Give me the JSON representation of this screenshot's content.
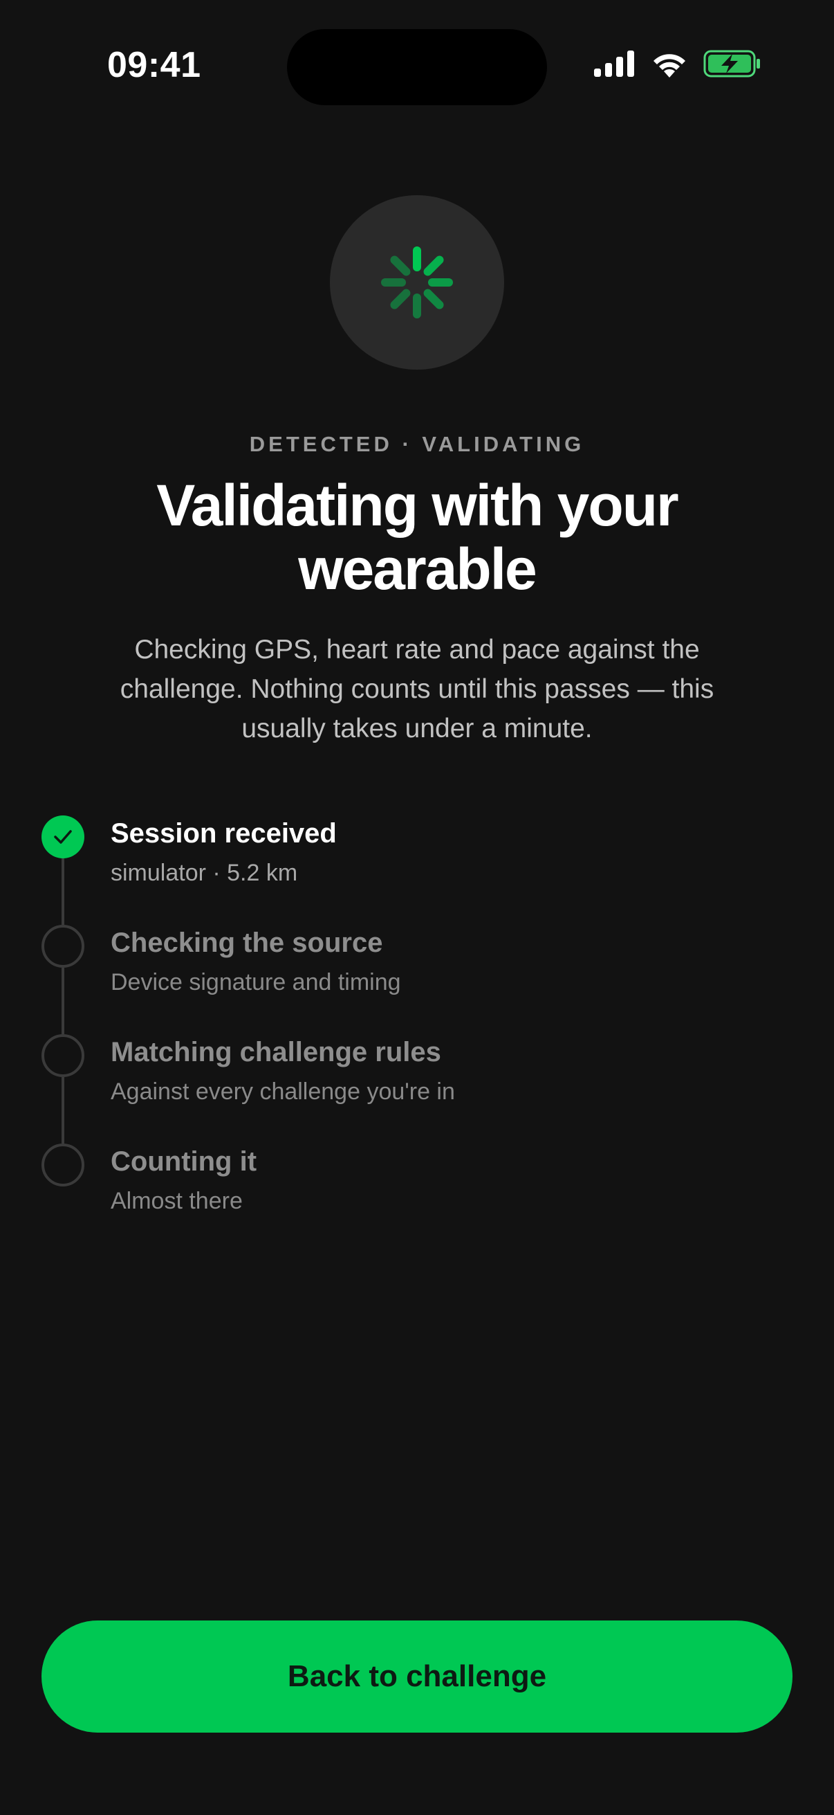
{
  "status_bar": {
    "time": "09:41",
    "icons": [
      "cellular-signal-icon",
      "wifi-icon",
      "battery-charging-icon"
    ]
  },
  "loader": {
    "icon": "spinner-icon",
    "accent_color": "#00c853"
  },
  "header": {
    "eyebrow": "DETECTED · VALIDATING",
    "title": "Validating with your wearable",
    "subtitle": "Checking GPS, heart rate and pace against the challenge. Nothing counts until this passes — this usually takes under a minute."
  },
  "steps": [
    {
      "title": "Session received",
      "desc": "simulator · 5.2 km",
      "status": "done"
    },
    {
      "title": "Checking the source",
      "desc": "Device signature and timing",
      "status": "pending"
    },
    {
      "title": "Matching challenge rules",
      "desc": "Against every challenge you're in",
      "status": "pending"
    },
    {
      "title": "Counting it",
      "desc": "Almost there",
      "status": "pending"
    }
  ],
  "cta": {
    "label": "Back to challenge"
  },
  "colors": {
    "background": "#121212",
    "accent": "#00c853",
    "pending_ring": "#3a3a3a"
  }
}
